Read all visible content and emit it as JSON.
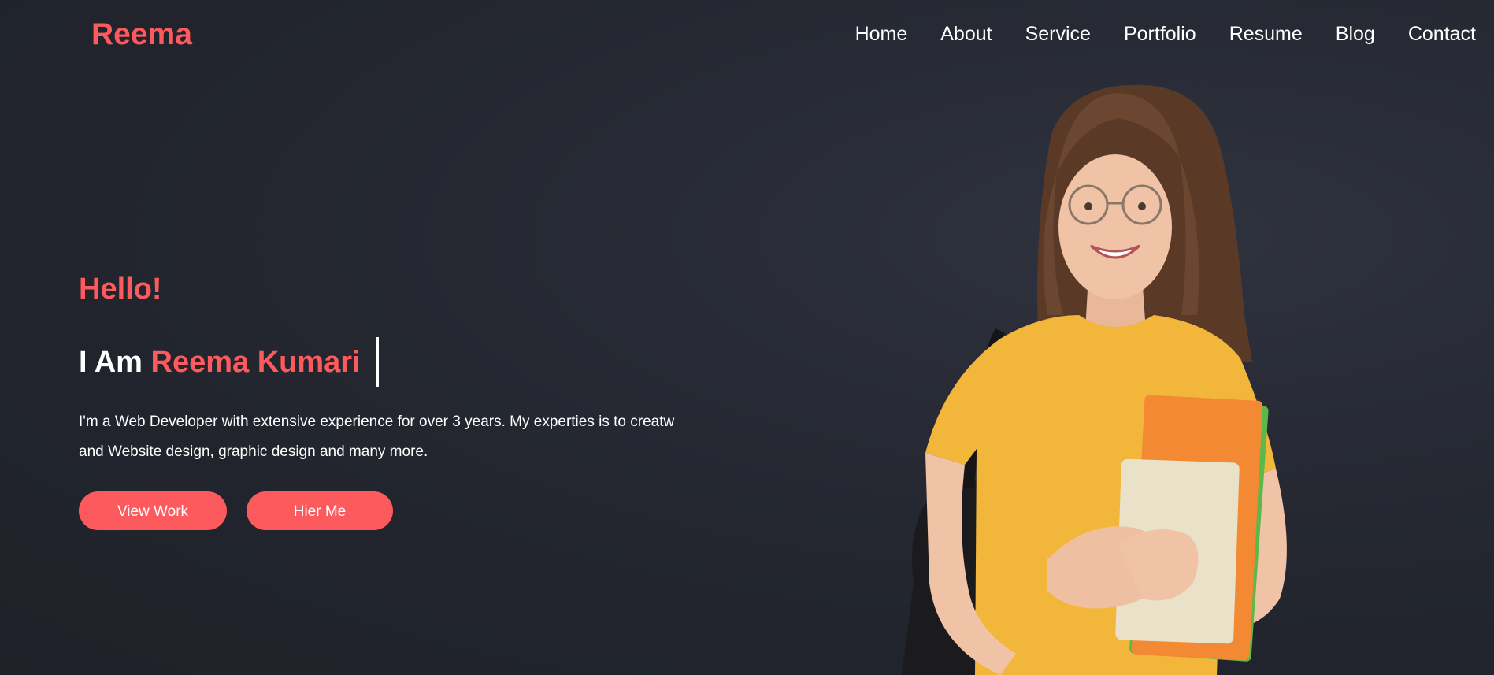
{
  "header": {
    "brand": "Reema",
    "nav": [
      "Home",
      "About",
      "Service",
      "Portfolio",
      "Resume",
      "Blog",
      "Contact"
    ]
  },
  "hero": {
    "greeting": "Hello!",
    "intro_prefix": "I Am",
    "name": "Reema Kumari",
    "bio": "I'm a Web Developer with extensive experience for over 3 years. My experties is to creatw and Website design, graphic design and many more.",
    "buttons": {
      "view_work": "View Work",
      "hire_me": "Hier Me"
    }
  },
  "colors": {
    "accent": "#fd5a5e",
    "background": "#22252d",
    "text": "#ffffff"
  }
}
